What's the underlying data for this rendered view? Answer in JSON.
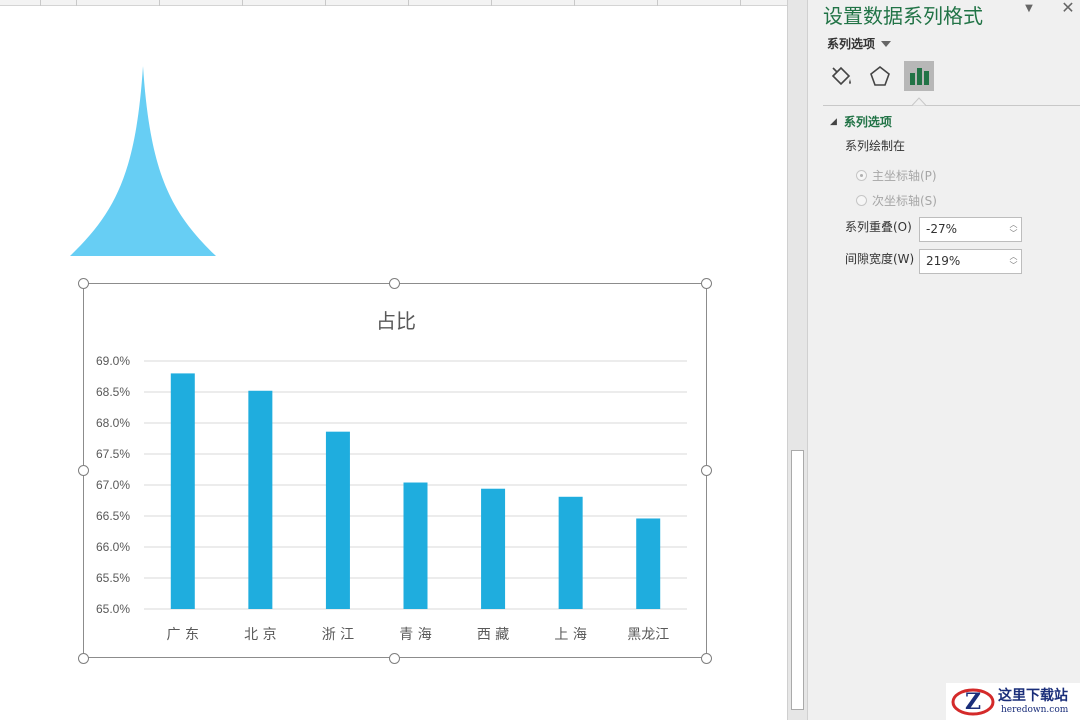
{
  "pane": {
    "title": "设置数据系列格式",
    "series_options_menu": "系列选项",
    "section_header": "系列选项",
    "plot_on_label": "系列绘制在",
    "radio_primary": "主坐标轴(P)",
    "radio_secondary": "次坐标轴(S)",
    "overlap_label": "系列重叠(O)",
    "overlap_value": "-27%",
    "gap_label": "间隙宽度(W)",
    "gap_value": "219%",
    "tab_icons": [
      "paint-bucket-icon",
      "pentagon-icon",
      "bar-chart-icon"
    ],
    "accent_color": "#217346"
  },
  "chart_data": {
    "type": "bar",
    "title": "占比",
    "categories": [
      "广 东",
      "北 京",
      "浙 江",
      "青 海",
      "西 藏",
      "上 海",
      "黑龙江"
    ],
    "values": [
      68.8,
      68.52,
      67.86,
      67.04,
      66.94,
      66.81,
      66.46
    ],
    "ylim": [
      65.0,
      69.0
    ],
    "yticks": [
      "65.0%",
      "65.5%",
      "66.0%",
      "66.5%",
      "67.0%",
      "67.5%",
      "68.0%",
      "68.5%",
      "69.0%"
    ],
    "ytick_values": [
      65.0,
      65.5,
      66.0,
      66.5,
      67.0,
      67.5,
      68.0,
      68.5,
      69.0
    ],
    "grid": true,
    "bar_color": "#1fadde",
    "xlabel": "",
    "ylabel": ""
  },
  "shape": {
    "fill_color": "#67cef4"
  },
  "watermark": {
    "name": "这里下载站",
    "url": "heredown.com"
  }
}
